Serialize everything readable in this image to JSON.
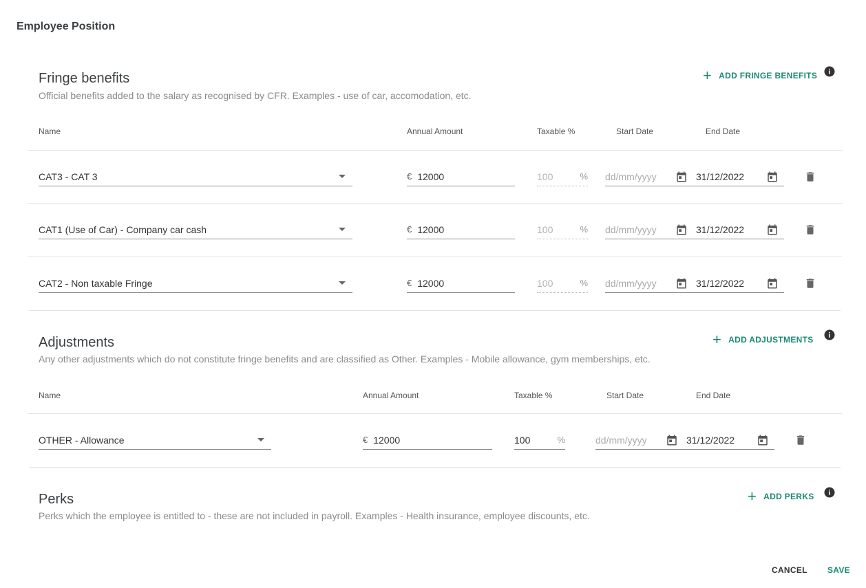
{
  "dialog": {
    "title": "Employee Position"
  },
  "fringe": {
    "title": "Fringe benefits",
    "description": "Official benefits added to the salary as recognised by CFR. Examples - use of car, accomodation, etc.",
    "add_label": "ADD FRINGE BENEFITS",
    "headers": {
      "name": "Name",
      "annual": "Annual Amount",
      "taxable": "Taxable %",
      "start": "Start Date",
      "end": "End Date"
    },
    "rows": [
      {
        "name": "CAT3 - CAT 3",
        "currency": "€",
        "amount": "12000",
        "taxable": "100",
        "pct": "%",
        "start_placeholder": "dd/mm/yyyy",
        "end": "31/12/2022"
      },
      {
        "name": "CAT1 (Use of Car) - Company car cash",
        "currency": "€",
        "amount": "12000",
        "taxable": "100",
        "pct": "%",
        "start_placeholder": "dd/mm/yyyy",
        "end": "31/12/2022"
      },
      {
        "name": "CAT2 - Non taxable Fringe",
        "currency": "€",
        "amount": "12000",
        "taxable": "100",
        "pct": "%",
        "start_placeholder": "dd/mm/yyyy",
        "end": "31/12/2022"
      }
    ]
  },
  "adjustments": {
    "title": "Adjustments",
    "description": "Any other adjustments which do not constitute fringe benefits and are classified as Other. Examples - Mobile allowance, gym memberships, etc.",
    "add_label": "ADD ADJUSTMENTS",
    "headers": {
      "name": "Name",
      "annual": "Annual Amount",
      "taxable": "Taxable %",
      "start": "Start Date",
      "end": "End Date"
    },
    "rows": [
      {
        "name": "OTHER - Allowance",
        "currency": "€",
        "amount": "12000",
        "taxable": "100",
        "pct": "%",
        "start_placeholder": "dd/mm/yyyy",
        "end": "31/12/2022"
      }
    ]
  },
  "perks": {
    "title": "Perks",
    "description": "Perks which the employee is entitled to - these are not included in payroll. Examples - Health insurance, employee discounts, etc.",
    "add_label": "ADD PERKS"
  },
  "footer": {
    "cancel": "CANCEL",
    "save": "SAVE"
  },
  "colors": {
    "accent": "#1a8a72",
    "text": "#3c4043",
    "muted": "#8a8a8a"
  }
}
